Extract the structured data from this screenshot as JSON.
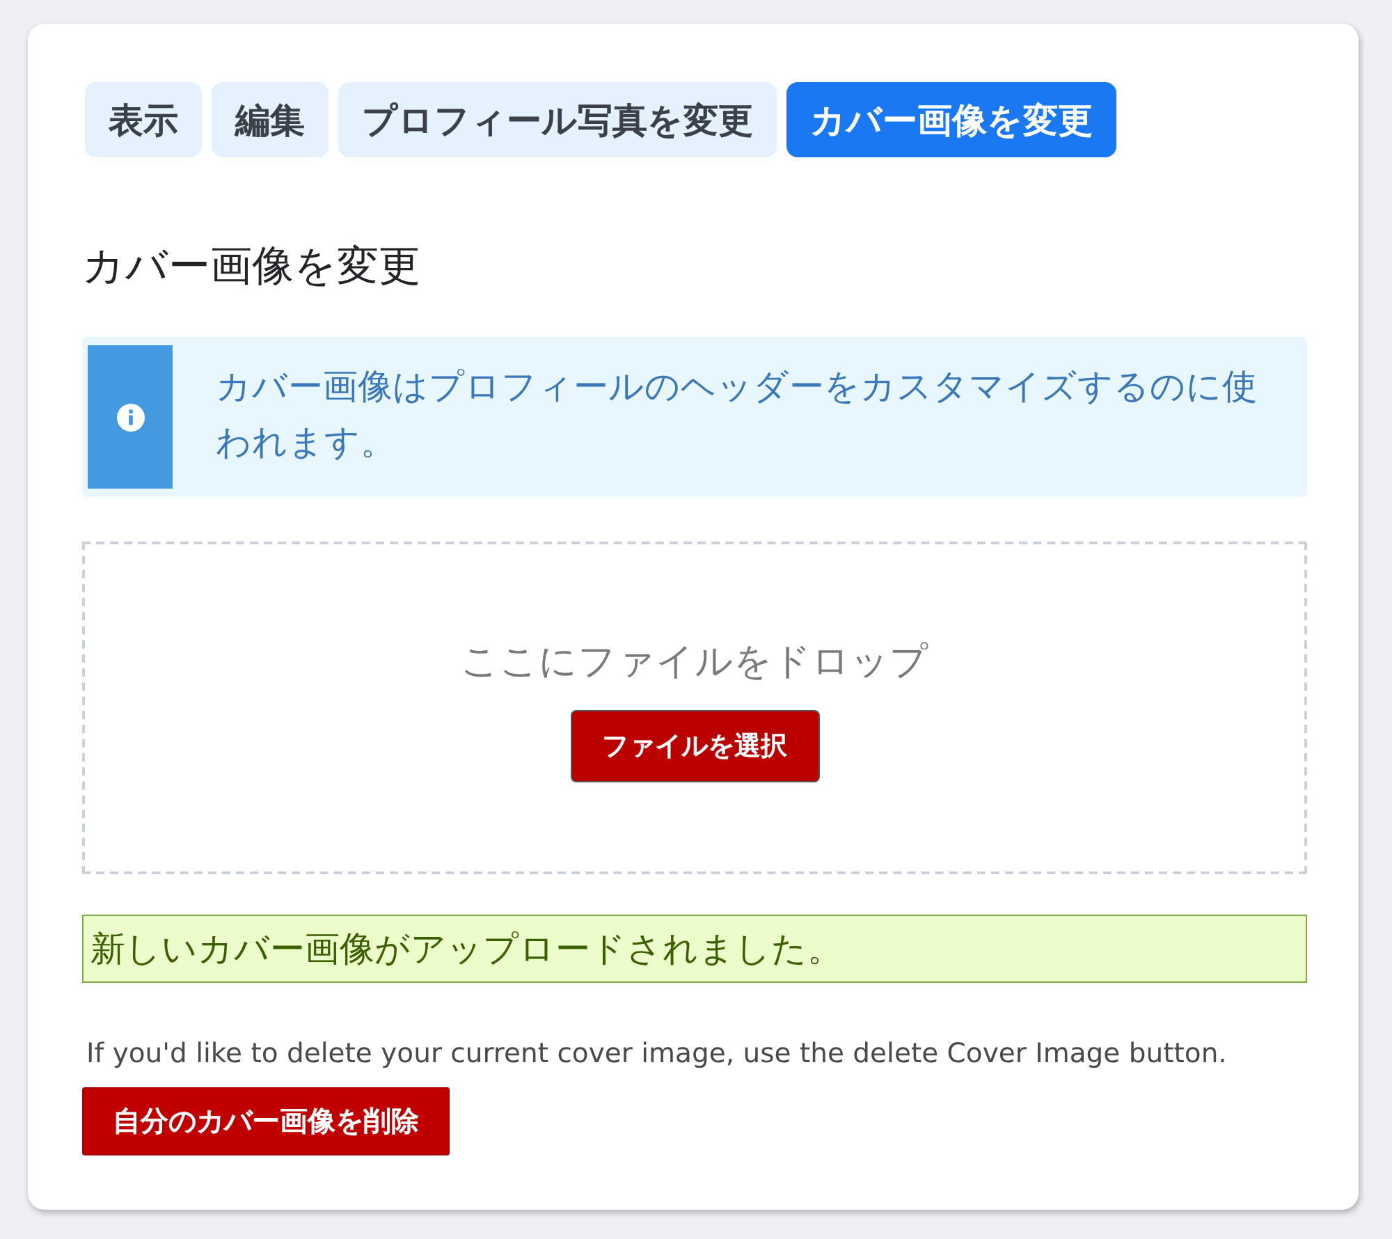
{
  "tabs": [
    {
      "label": "表示",
      "selected": false
    },
    {
      "label": "編集",
      "selected": false
    },
    {
      "label": "プロフィール写真を変更",
      "selected": false
    },
    {
      "label": "カバー画像を変更",
      "selected": true
    }
  ],
  "section_title": "カバー画像を変更",
  "info_notice": {
    "text": "カバー画像はプロフィールのヘッダーをカスタマイズするのに使われます。"
  },
  "dropzone": {
    "prompt": "ここにファイルをドロップ",
    "button": "ファイルを選択"
  },
  "success_message": "新しいカバー画像がアップロードされました。",
  "delete_section": {
    "help_text": "If you'd like to delete your current cover image, use the delete Cover Image button.",
    "button": "自分のカバー画像を削除"
  }
}
